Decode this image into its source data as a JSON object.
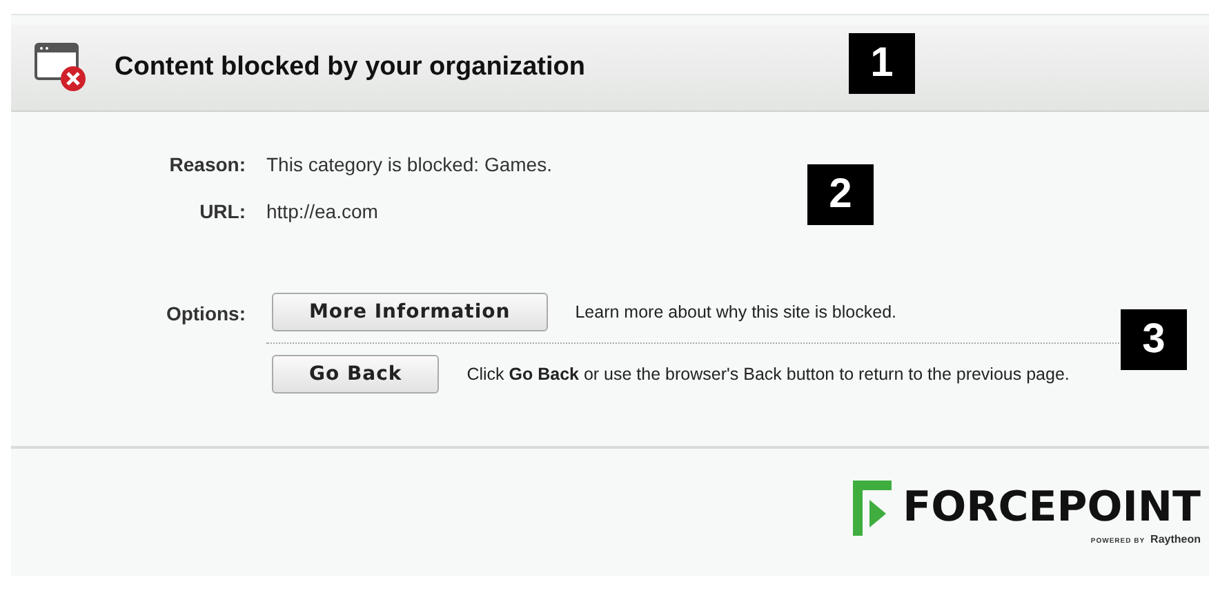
{
  "header": {
    "title": "Content blocked by your organization"
  },
  "details": [
    {
      "label": "Reason:",
      "value": "This category is blocked: Games."
    },
    {
      "label": "URL:",
      "value": "http://ea.com"
    }
  ],
  "options": {
    "label": "Options:",
    "items": [
      {
        "button": "More Information",
        "description": "Learn more about why this site is blocked."
      },
      {
        "button": "Go Back",
        "description": "Click **Go Back** or use the browser's Back button to return to the previous page."
      }
    ]
  },
  "callouts": [
    "1",
    "2",
    "3"
  ],
  "logo": {
    "name": "FORCEPOINT",
    "tagline": "POWERED BY",
    "brand": "Raytheon"
  }
}
